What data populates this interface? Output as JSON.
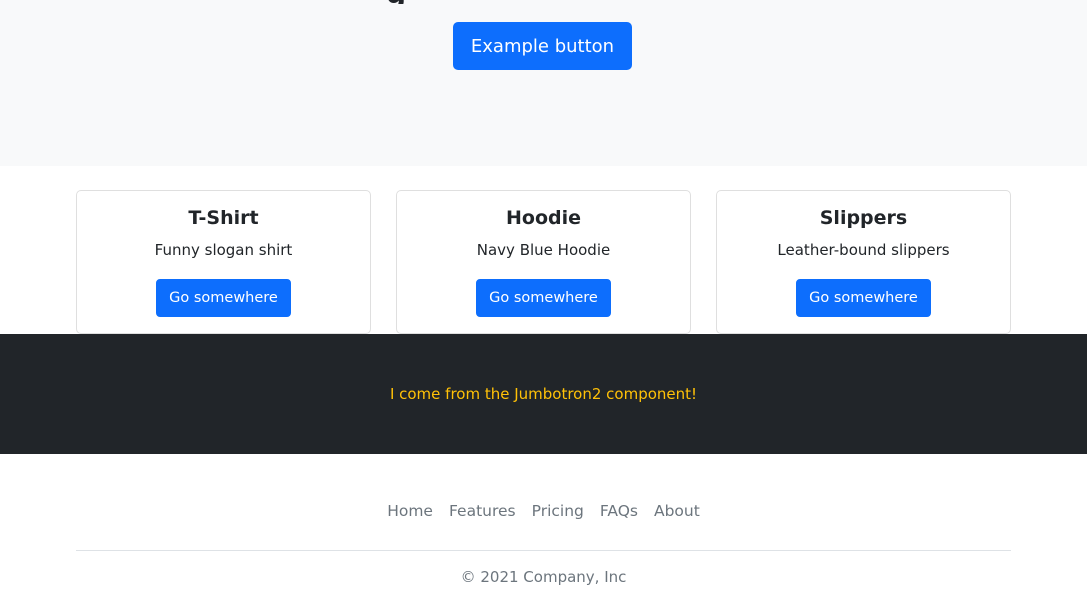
{
  "hero": {
    "heading_fragment": "g",
    "button_label": "Example button"
  },
  "cards": [
    {
      "title": "T-Shirt",
      "text": "Funny slogan shirt",
      "button_label": "Go somewhere"
    },
    {
      "title": "Hoodie",
      "text": "Navy Blue Hoodie",
      "button_label": "Go somewhere"
    },
    {
      "title": "Slippers",
      "text": "Leather-bound slippers",
      "button_label": "Go somewhere"
    }
  ],
  "jumbotron2": {
    "text": "I come from the Jumbotron2 component!"
  },
  "footer": {
    "nav": [
      "Home",
      "Features",
      "Pricing",
      "FAQs",
      "About"
    ],
    "copyright": "© 2021 Company, Inc"
  },
  "colors": {
    "primary": "#0d6efd",
    "hero_bg": "#f8f9fa",
    "dark_bg": "#212529",
    "warning_text": "#ffc107",
    "muted_text": "#6c757d"
  }
}
